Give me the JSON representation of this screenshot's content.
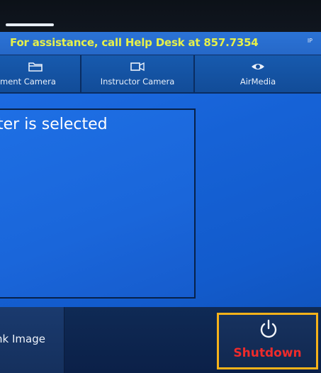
{
  "header": {
    "help_text": "For assistance, call Help Desk at 857.7354",
    "corner_text": "IP"
  },
  "sources": [
    {
      "label": "ment Camera",
      "icon": "folder-icon"
    },
    {
      "label": "Instructor Camera",
      "icon": "video-camera-icon"
    },
    {
      "label": "AirMedia",
      "icon": "eye-icon"
    }
  ],
  "preview": {
    "message": "ter is selected"
  },
  "controls": {
    "blank_label": "nk Image",
    "shutdown_label": "Shutdown"
  },
  "colors": {
    "panel_blue": "#1662d6",
    "help_text_yellow": "#e6f04a",
    "shutdown_red": "#ee2b2b",
    "highlight_orange": "#f6b21a"
  }
}
